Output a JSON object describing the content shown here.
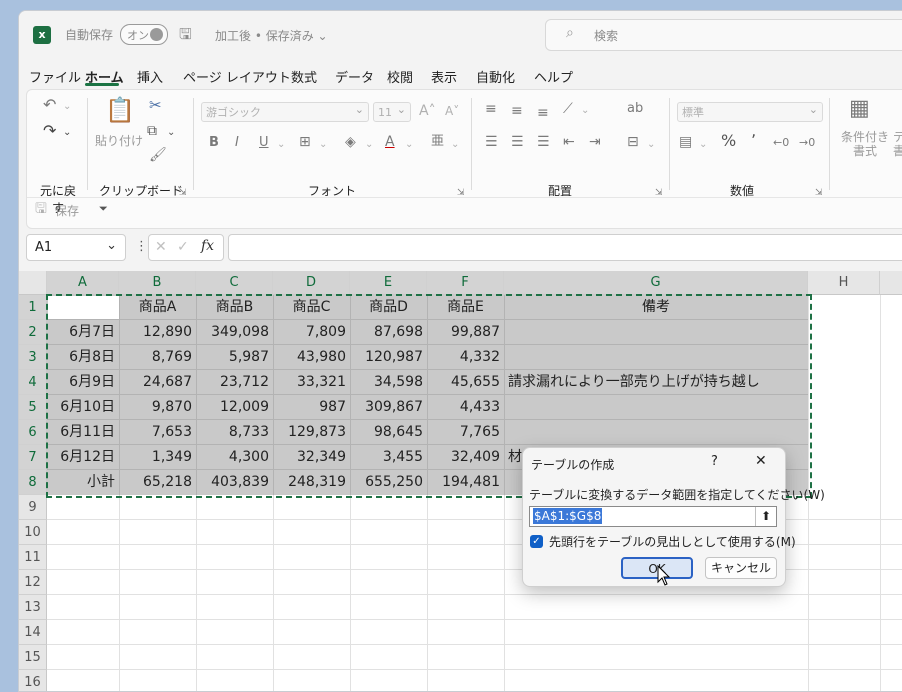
{
  "titlebar": {
    "autosave_label": "自動保存",
    "autosave_toggle": "オン",
    "document_title": "加工後 • 保存済み ⌄",
    "search_placeholder": "検索"
  },
  "menu": {
    "tabs": [
      "ファイル",
      "ホーム",
      "挿入",
      "ページ レイアウト",
      "数式",
      "データ",
      "校閲",
      "表示",
      "自動化",
      "ヘルプ"
    ],
    "active_tab": "ホーム"
  },
  "ribbon": {
    "groups": {
      "undo": "元に戻す",
      "clipboard": "クリップボード",
      "font": "フォント",
      "alignment": "配置",
      "number": "数値"
    },
    "paste_label": "貼り付け",
    "font_name": "游ゴシック",
    "font_size": "11",
    "number_format": "標準",
    "conditional_format_label": "条件付き 書式",
    "table_format_label": "テ 書",
    "qat_save_label": "保存",
    "font_buttons": [
      "B",
      "I",
      "U"
    ],
    "font_grow": "A˄",
    "font_shrink": "A˅",
    "percent": "%",
    "comma": "ʼ"
  },
  "formula_bar": {
    "name_box": "A1",
    "fx": "fx",
    "formula": ""
  },
  "sheet": {
    "columns": [
      "A",
      "B",
      "C",
      "D",
      "E",
      "F",
      "G",
      "H"
    ],
    "row_numbers": [
      "1",
      "2",
      "3",
      "4",
      "5",
      "6",
      "7",
      "8",
      "9",
      "10",
      "11",
      "12",
      "13",
      "14",
      "15",
      "16"
    ],
    "header_row": [
      "",
      "商品A",
      "商品B",
      "商品C",
      "商品D",
      "商品E",
      "備考"
    ],
    "rows": [
      [
        "6月7日",
        "12,890",
        "349,098",
        "7,809",
        "87,698",
        "99,887",
        ""
      ],
      [
        "6月8日",
        "8,769",
        "5,987",
        "43,980",
        "120,987",
        "4,332",
        ""
      ],
      [
        "6月9日",
        "24,687",
        "23,712",
        "33,321",
        "34,598",
        "45,655",
        "請求漏れにより一部売り上げが持ち越し"
      ],
      [
        "6月10日",
        "9,870",
        "12,009",
        "987",
        "309,867",
        "4,433",
        ""
      ],
      [
        "6月11日",
        "7,653",
        "8,733",
        "129,873",
        "98,645",
        "7,765",
        ""
      ],
      [
        "6月12日",
        "1,349",
        "4,300",
        "32,349",
        "3,455",
        "32,409",
        "材"
      ],
      [
        "小計",
        "65,218",
        "403,839",
        "248,319",
        "655,250",
        "194,481",
        ""
      ]
    ]
  },
  "dialog": {
    "title": "テーブルの作成",
    "help": "?",
    "close": "✕",
    "prompt": "テーブルに変換するデータ範囲を指定してください(W)",
    "range": "$A$1:$G$8",
    "checkbox_label": "先頭行をテーブルの見出しとして使用する(M)",
    "checkbox_checked": true,
    "ok": "OK",
    "cancel": "キャンセル"
  },
  "colors": {
    "accent_green": "#1d6f42",
    "selection_gray": "#c9c9c9",
    "dialog_ok_border": "#2b62c4"
  }
}
